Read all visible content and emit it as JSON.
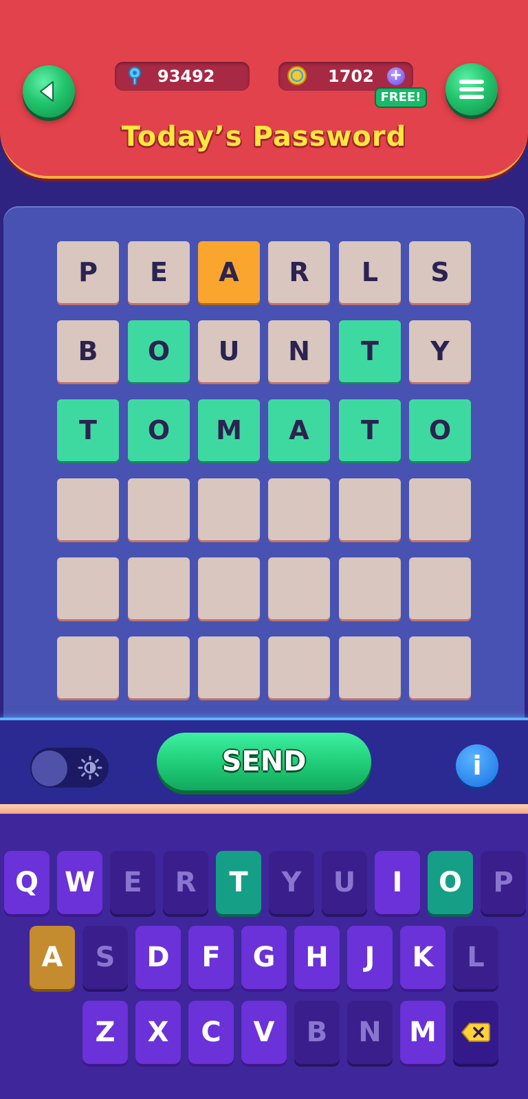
{
  "header": {
    "title": "Today’s Password",
    "hints_count": "93492",
    "coins_count": "1702",
    "free_badge": "FREE!",
    "plus_symbol": "+",
    "icons": {
      "back": "back-arrow-icon",
      "menu": "hamburger-menu-icon",
      "hints": "key-icon",
      "coins": "coin-icon",
      "plus": "plus-icon"
    }
  },
  "board": {
    "rows": [
      [
        {
          "letter": "P",
          "state": "gray"
        },
        {
          "letter": "E",
          "state": "gray"
        },
        {
          "letter": "A",
          "state": "yellow"
        },
        {
          "letter": "R",
          "state": "gray"
        },
        {
          "letter": "L",
          "state": "gray"
        },
        {
          "letter": "S",
          "state": "gray"
        }
      ],
      [
        {
          "letter": "B",
          "state": "gray"
        },
        {
          "letter": "O",
          "state": "green"
        },
        {
          "letter": "U",
          "state": "gray"
        },
        {
          "letter": "N",
          "state": "gray"
        },
        {
          "letter": "T",
          "state": "green"
        },
        {
          "letter": "Y",
          "state": "gray"
        }
      ],
      [
        {
          "letter": "T",
          "state": "green"
        },
        {
          "letter": "O",
          "state": "green"
        },
        {
          "letter": "M",
          "state": "green"
        },
        {
          "letter": "A",
          "state": "green"
        },
        {
          "letter": "T",
          "state": "green"
        },
        {
          "letter": "O",
          "state": "green"
        }
      ],
      [
        {
          "letter": "",
          "state": "empty"
        },
        {
          "letter": "",
          "state": "empty"
        },
        {
          "letter": "",
          "state": "empty"
        },
        {
          "letter": "",
          "state": "empty"
        },
        {
          "letter": "",
          "state": "empty"
        },
        {
          "letter": "",
          "state": "empty"
        }
      ],
      [
        {
          "letter": "",
          "state": "empty"
        },
        {
          "letter": "",
          "state": "empty"
        },
        {
          "letter": "",
          "state": "empty"
        },
        {
          "letter": "",
          "state": "empty"
        },
        {
          "letter": "",
          "state": "empty"
        },
        {
          "letter": "",
          "state": "empty"
        }
      ],
      [
        {
          "letter": "",
          "state": "empty"
        },
        {
          "letter": "",
          "state": "empty"
        },
        {
          "letter": "",
          "state": "empty"
        },
        {
          "letter": "",
          "state": "empty"
        },
        {
          "letter": "",
          "state": "empty"
        },
        {
          "letter": "",
          "state": "empty"
        }
      ]
    ]
  },
  "controls": {
    "send_label": "SEND",
    "info_label": "i",
    "dark_mode_on": false,
    "icons": {
      "theme": "sun-icon",
      "info": "info-icon"
    }
  },
  "keyboard": {
    "rows": [
      [
        {
          "key": "Q",
          "state": "normal"
        },
        {
          "key": "W",
          "state": "normal"
        },
        {
          "key": "E",
          "state": "used"
        },
        {
          "key": "R",
          "state": "used"
        },
        {
          "key": "T",
          "state": "green"
        },
        {
          "key": "Y",
          "state": "used"
        },
        {
          "key": "U",
          "state": "used"
        },
        {
          "key": "I",
          "state": "normal"
        },
        {
          "key": "O",
          "state": "green"
        },
        {
          "key": "P",
          "state": "used"
        }
      ],
      [
        {
          "key": "A",
          "state": "yellow"
        },
        {
          "key": "S",
          "state": "used"
        },
        {
          "key": "D",
          "state": "normal"
        },
        {
          "key": "F",
          "state": "normal"
        },
        {
          "key": "G",
          "state": "normal"
        },
        {
          "key": "H",
          "state": "normal"
        },
        {
          "key": "J",
          "state": "normal"
        },
        {
          "key": "K",
          "state": "normal"
        },
        {
          "key": "L",
          "state": "used"
        }
      ],
      [
        {
          "key": "Z",
          "state": "normal"
        },
        {
          "key": "X",
          "state": "normal"
        },
        {
          "key": "C",
          "state": "normal"
        },
        {
          "key": "V",
          "state": "normal"
        },
        {
          "key": "B",
          "state": "used"
        },
        {
          "key": "N",
          "state": "used"
        },
        {
          "key": "M",
          "state": "normal"
        },
        {
          "key": "",
          "state": "delete"
        }
      ]
    ],
    "icons": {
      "delete": "backspace-icon"
    }
  },
  "colors": {
    "header_red": "#e2424b",
    "title_yellow": "#ffe83b",
    "tile_green": "#3ed9a1",
    "tile_yellow": "#f9a52e",
    "tile_gray": "#d8c6bf",
    "key_purple": "#6a32d8",
    "send_green": "#1fcc76"
  }
}
